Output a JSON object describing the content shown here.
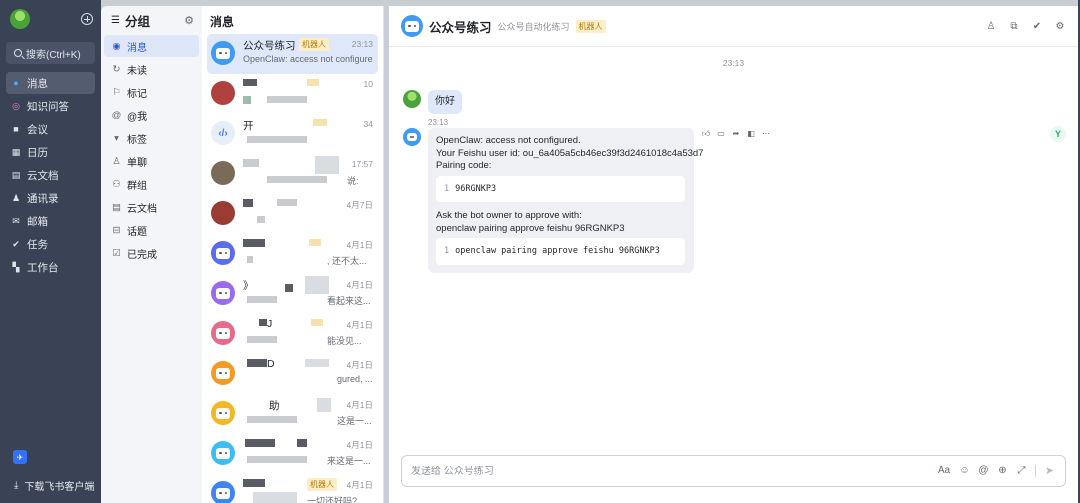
{
  "nav": {
    "search_label": "搜索(Ctrl+K)",
    "items": [
      {
        "label": "消息",
        "icon": "chat-bubble-icon"
      },
      {
        "label": "知识问答",
        "icon": "ring-icon"
      },
      {
        "label": "会议",
        "icon": "video-icon"
      },
      {
        "label": "日历",
        "icon": "calendar-icon"
      },
      {
        "label": "云文档",
        "icon": "doc-icon"
      },
      {
        "label": "通讯录",
        "icon": "contacts-icon"
      },
      {
        "label": "邮箱",
        "icon": "mail-icon"
      },
      {
        "label": "任务",
        "icon": "check-icon"
      },
      {
        "label": "工作台",
        "icon": "grid-icon"
      }
    ],
    "download_label": "下载飞书客户端"
  },
  "groups": {
    "title": "分组",
    "items": [
      {
        "label": "消息",
        "icon": "message-icon"
      },
      {
        "label": "未读",
        "icon": "unread-icon"
      },
      {
        "label": "标记",
        "icon": "flag-icon"
      },
      {
        "label": "@我",
        "icon": "at-icon"
      },
      {
        "label": "标签",
        "icon": "tag-icon"
      },
      {
        "label": "单聊",
        "icon": "person-icon"
      },
      {
        "label": "群组",
        "icon": "group-icon"
      },
      {
        "label": "云文档",
        "icon": "doc-icon"
      },
      {
        "label": "话题",
        "icon": "topic-icon"
      },
      {
        "label": "已完成",
        "icon": "done-icon"
      }
    ]
  },
  "list": {
    "title": "消息",
    "active_chat": {
      "name": "公众号练习",
      "tag": "机器人",
      "time": "23:13",
      "preview": "OpenClaw: access not configured, ..."
    },
    "chats": [
      {
        "name": "",
        "time": "10",
        "preview": ""
      },
      {
        "name": "开",
        "time": "34",
        "preview": ""
      },
      {
        "name": "",
        "time": "17:57",
        "preview": "说:"
      },
      {
        "name": "",
        "time": "4月7日",
        "preview": ""
      },
      {
        "name": "",
        "time": "4月1日",
        "preview": ", 还不太..."
      },
      {
        "name": "》",
        "time": "4月1日",
        "preview": "看起来这..."
      },
      {
        "name": "J",
        "time": "4月1日",
        "preview": "能没见..."
      },
      {
        "name": "D",
        "time": "4月1日",
        "preview": "gured, ..."
      },
      {
        "name": "助",
        "time": "4月1日",
        "preview": "这是一..."
      },
      {
        "name": "",
        "time": "4月1日",
        "preview": "来这是一..."
      },
      {
        "name": "",
        "time": "4月1日",
        "tag": "机器人",
        "preview": "一切还好吗?"
      }
    ]
  },
  "chat": {
    "title": "公众号练习",
    "subtitle": "公众号自动化练习",
    "tag": "机器人",
    "time_separator": "23:13",
    "user_message": "你好",
    "bot_time": "23:13",
    "bot_message": {
      "line1": "OpenClaw: access not configured.",
      "line2": "Your Feishu user id: ou_6a405a5cb46ec39f3d2461018c4a53d7",
      "line3": "Pairing code:",
      "code1_num": "1",
      "code1": "96RGNKP3",
      "line4": "Ask the bot owner to approve with:",
      "line5": "openclaw pairing approve feishu 96RGNKP3",
      "code2_num": "1",
      "code2": "openclaw pairing approve feishu 96RGNKP3"
    },
    "composer_placeholder": "发送给 公众号练习",
    "format_label": "Aa"
  },
  "colors": {
    "nav_bg": "#3a4356",
    "accent": "#3370ff",
    "bot_avatar": "#3d9bf5",
    "bot_tag_bg": "#fcefc8",
    "bot_tag_text": "#b87b06"
  }
}
